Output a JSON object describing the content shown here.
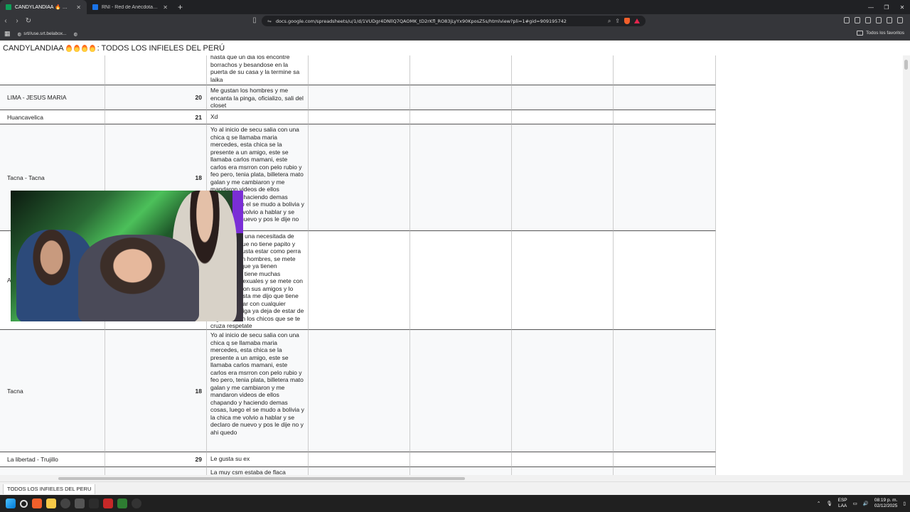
{
  "browser": {
    "tabs": [
      {
        "title": "CANDYLANDIAA 🔥 🔥 🔥 🔥 - G",
        "active": true,
        "color": "#0f9d58"
      },
      {
        "title": "RNI - Red de Anécdotas de Infidelidad",
        "active": false,
        "color": "#1a73e8"
      }
    ],
    "url": "docs.google.com/spreadsheets/u/1/d/1VUDgr4DNllQ7QAOMK_tD2rKfl_RO83jLyYx90KposZ5s/htmlview?pli=1#gid=909195742",
    "bookmarks": [
      {
        "label": "srt//use.srt.belabox..."
      }
    ],
    "all_bookmarks": "Todos los favoritos"
  },
  "sheet": {
    "title": "CANDYLANDIAA 🔥 🔥 🔥 🔥 : TODOS LOS INFIELES DEL PERÚ",
    "title_text": "CANDYLANDIAA",
    "title_suffix": ": TODOS LOS INFIELES DEL PERÚ",
    "tab": "TODOS LOS INFIELES DEL PERU",
    "rows": [
      {
        "location": "",
        "age": "",
        "text": "hasta que un dia los encontre borrachos y besandose en la puerta de su casa y la termine sa laika"
      },
      {
        "location": "LIMA - JESUS MARIA",
        "age": "20",
        "text": "Me gustan los hombres y me encanta la pinga, oficializo, sali del closet"
      },
      {
        "location": "Huancavelica",
        "age": "21",
        "text": "Xd"
      },
      {
        "location": "Tacna - Tacna",
        "age": "18",
        "text": "Yo al inicio de secu salia con una chica q se llamaba maria mercedes, esta chica se la presente a un amigo, este se llamaba carlos mamani, este carlos era msrron con pelo rubio y feo pero, tenia plata, billetera mato galan y me cambiaron y me mandaron videos de ellos chapando y haciendo demas cosas, luego el se mudo a bolivia y la chica me volvio a hablar y se declaro de nuevo y pos le dije no"
      },
      {
        "location": "A",
        "age": "",
        "text": "Mi amiga es una necesitada de cariño, porque no tiene papito y por eso le gusta estar como perra andando con hombres, se mete con chicos que ya tienen enamorada, tiene muchas relaciones sexuales y se mete con cualquiera con sus amigos y lo peor que hasta me dijo que tiene VIH por andar con cualquier hombre, amiga ya deja de estar de regalona con los chicos que se te cruza respetate"
      },
      {
        "location": "Tacna",
        "age": "18",
        "text": "Yo al inicio de secu salia con una chica q se llamaba maria mercedes, esta chica se la presente a un amigo, este se llamaba carlos mamani, este carlos era msrron con pelo rubio y feo pero, tenia plata, billetera mato galan y me cambiaron y me mandaron videos de ellos chapando y haciendo demas cosas, luego el se mudo a bolivia y la chica me volvio a hablar y se declaro de nuevo y pos le dije no y ahi quedo"
      },
      {
        "location": "La libertad - Trujillo",
        "age": "29",
        "text": "Le gusta su ex"
      },
      {
        "location": "",
        "age": "",
        "text": "La muy csm estaba de flaca"
      }
    ]
  },
  "taskbar": {
    "lang": "ESP",
    "lang2": "LAA",
    "time": "08:19 p. m.",
    "date": "02/12/2025"
  }
}
